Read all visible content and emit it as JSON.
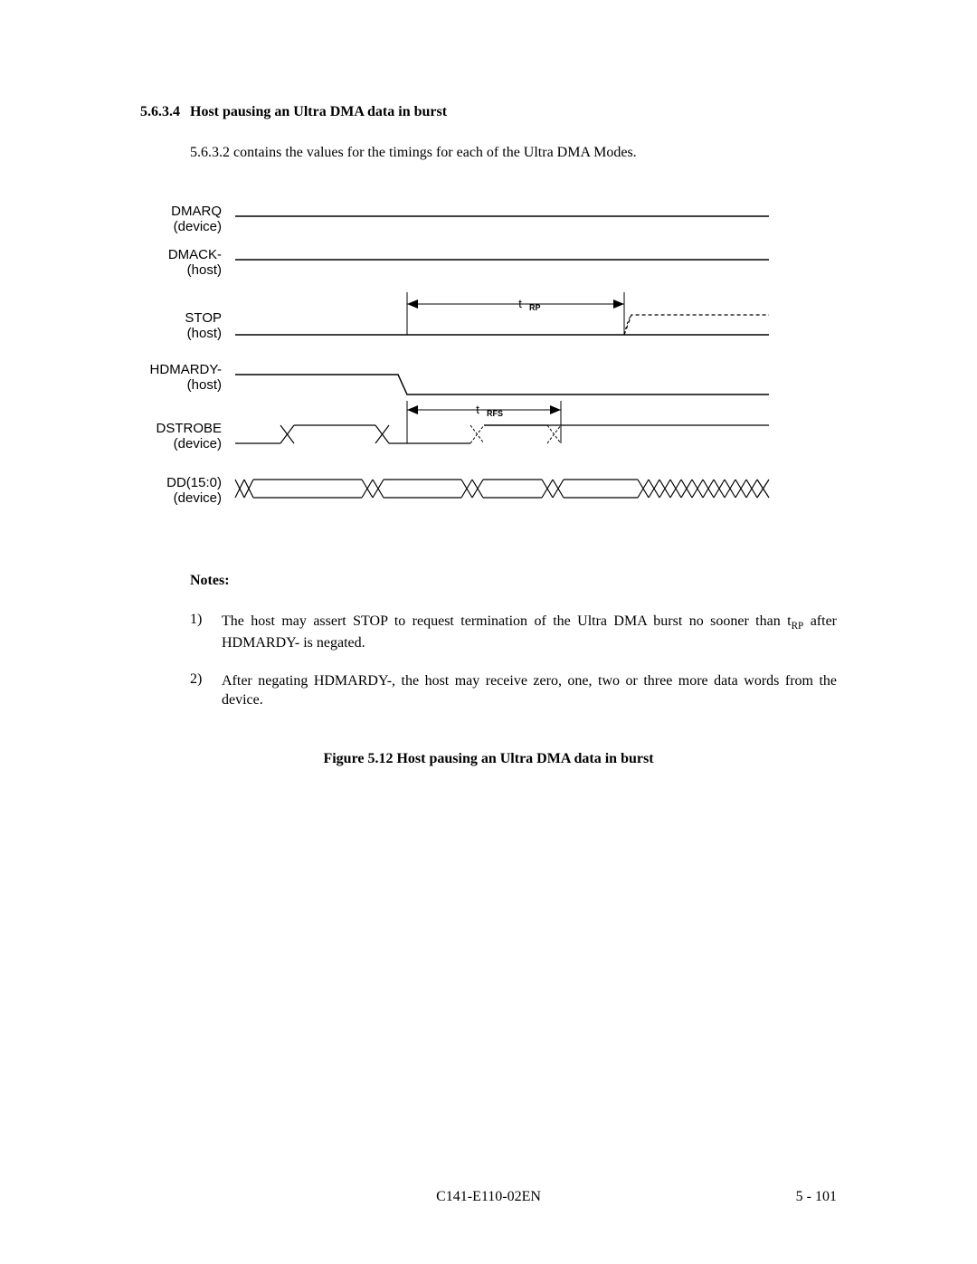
{
  "section": {
    "number": "5.6.3.4",
    "title": "Host pausing an Ultra DMA data in burst",
    "intro": "5.6.3.2 contains the values for the timings for each of the Ultra DMA Modes."
  },
  "signals": [
    {
      "name": "DMARQ",
      "owner": "(device)"
    },
    {
      "name": "DMACK-",
      "owner": "(host)"
    },
    {
      "name": "STOP",
      "owner": "(host)"
    },
    {
      "name": "HDMARDY-",
      "owner": "(host)"
    },
    {
      "name": "DSTROBE",
      "owner": "(device)"
    },
    {
      "name": "DD(15:0)",
      "owner": "(device)"
    }
  ],
  "timing_labels": {
    "trp": "RP",
    "trfs": "RFS"
  },
  "notes": {
    "heading": "Notes:",
    "items": [
      {
        "num": "1)",
        "text_before": "The host may assert STOP to request termination of the Ultra DMA burst no sooner than t",
        "sub": "RP",
        "text_after": " after HDMARDY- is negated."
      },
      {
        "num": "2)",
        "text_before": "After negating HDMARDY-, the host may receive zero, one, two or three more data words from the device.",
        "sub": "",
        "text_after": ""
      }
    ]
  },
  "figure_caption": "Figure 5.12   Host pausing an Ultra DMA data in burst",
  "footer": {
    "center": "C141-E110-02EN",
    "right": "5 - 101"
  }
}
